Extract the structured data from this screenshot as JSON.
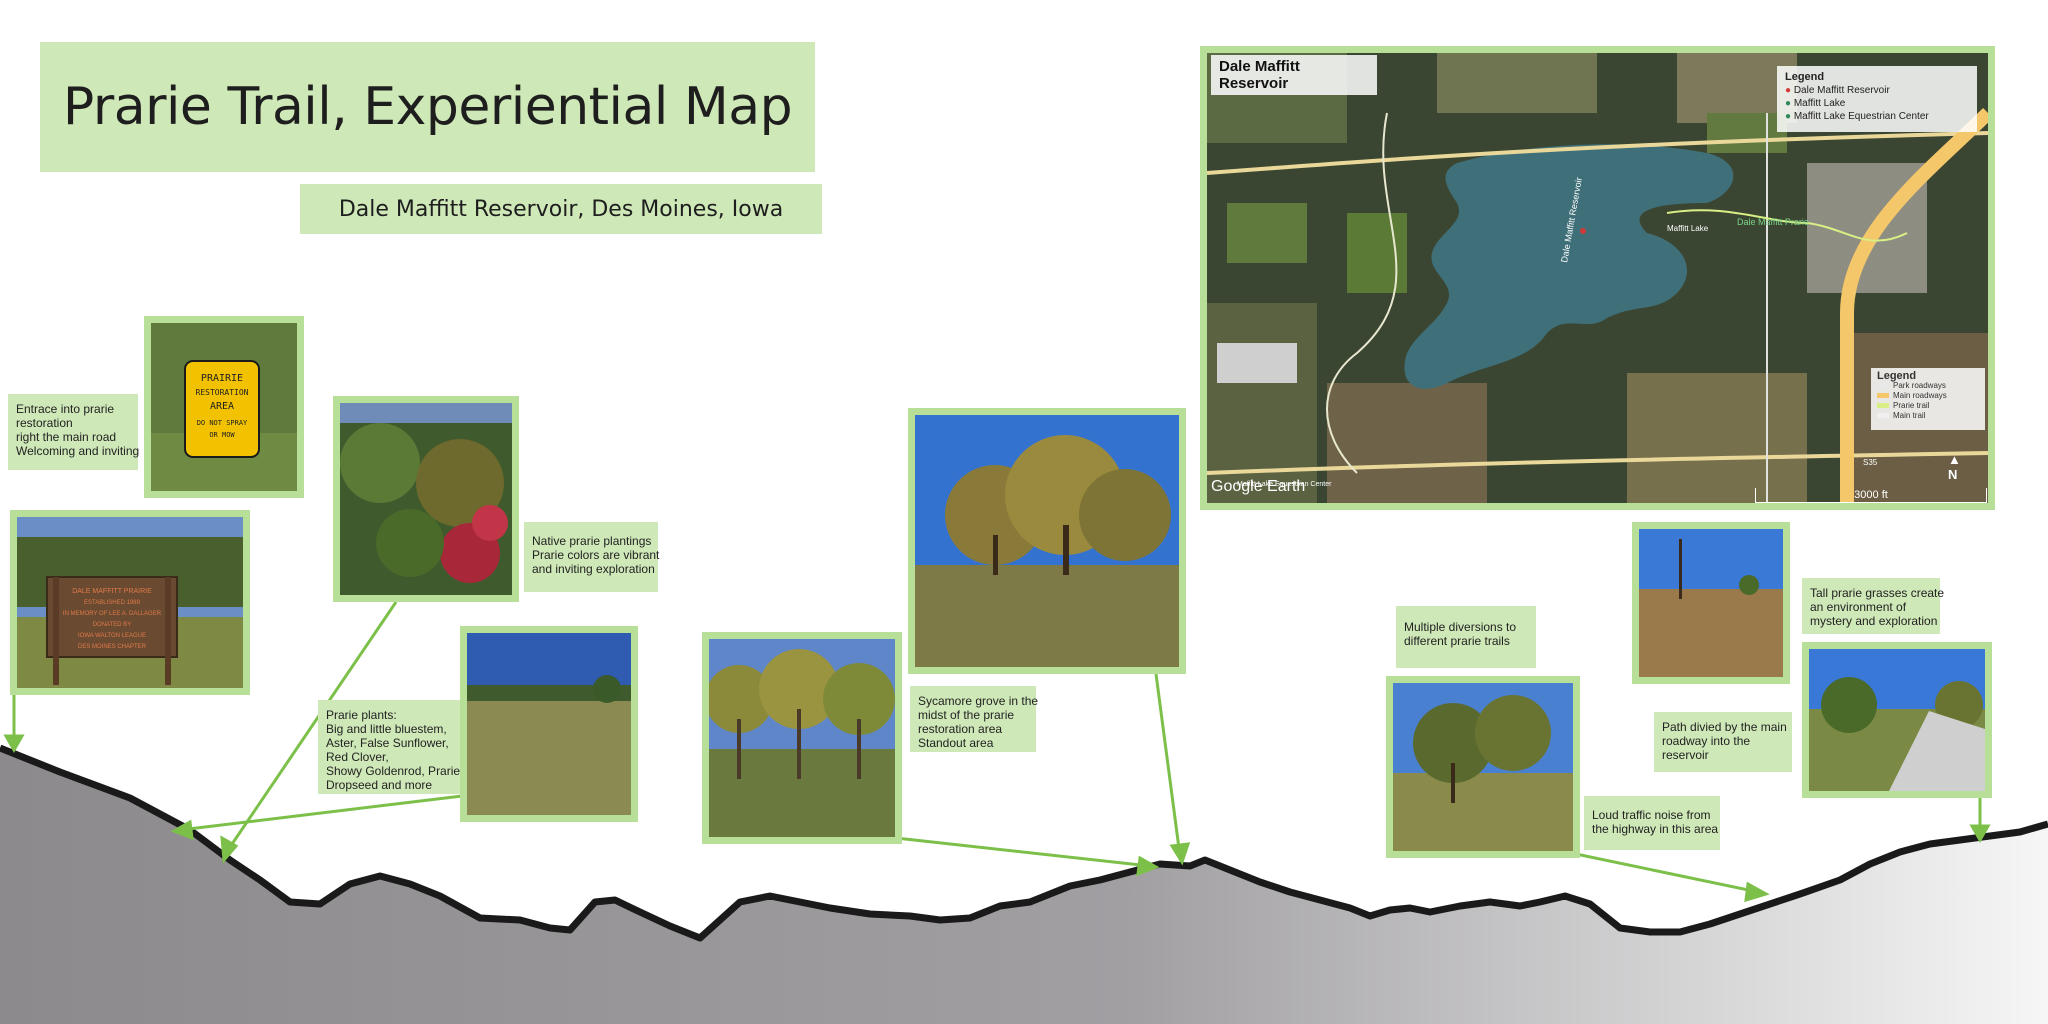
{
  "title": "Prarie Trail, Experiential  Map",
  "subtitle": "Dale Maffitt Reservoir, Des Moines, Iowa",
  "map": {
    "title_line1": "Dale Maffitt",
    "title_line2": "Reservoir",
    "legend_title": "Legend",
    "legend_items": [
      "Dale Maffitt Reservoir",
      "Maffitt Lake",
      "Maffitt Lake Equestrian Center"
    ],
    "legend2_title": "Legend",
    "legend2_items": [
      "Park roadways",
      "Main roadways",
      "Prarie trail",
      "Main trail"
    ],
    "legend2_colors": [
      "#e8e8e8",
      "#f4c86a",
      "#d8ef86",
      "#f0f0f0"
    ],
    "watermark": "Google Earth",
    "scale": "3000 ft",
    "north": "N",
    "label_reservoir": "Dale Maffitt Reservoir",
    "label_lake": "Maffitt Lake",
    "label_trail": "Dale Maffitt Prarie",
    "label_equestrian": "Maffitt Lake Equestrian Center",
    "route_number": "S35",
    "colors": {
      "water": "#3f6f78",
      "forest": "#2f3a27",
      "field": "#6f7a4e",
      "road": "#e9d89a",
      "highway": "#f4c86a"
    }
  },
  "notes": {
    "entrance": [
      "Entrace into prarie",
      "restoration",
      "right the main road",
      "Welcoming and inviting"
    ],
    "native": [
      "Native prarie plantings",
      "Prarie colors are vibrant",
      "and inviting exploration"
    ],
    "plants": [
      "Prarie plants:",
      "Big and little bluestem,",
      "Aster, False Sunflower,",
      "Red Clover,",
      "Showy Goldenrod, Prarie",
      "Dropseed and more"
    ],
    "sycamore": [
      "Sycamore grove in the",
      "midst of the prarie",
      "restoration area",
      "Standout area"
    ],
    "diversions": [
      "Multiple diversions to",
      "different prarie trails"
    ],
    "traffic": [
      "Loud traffic noise from",
      "the highway in this area"
    ],
    "path": [
      "Path divied by the main",
      "roadway into the",
      "reservoir"
    ],
    "tall": [
      "Tall prarie grasses create",
      "an environment of",
      "mystery and exploration"
    ]
  },
  "signs": {
    "prairie_sign": [
      "PRAIRIE",
      "RESTORATION",
      "AREA",
      "DO NOT SPRAY",
      "OR MOW"
    ],
    "memorial_sign": [
      "DALE MAFFITT PRAIRIE",
      "ESTABLISHED 1989",
      "IN MEMORY OF LEE A. DALLAGER",
      "DONATED BY",
      "IOWA WALTON LEAGUE",
      "DES MOINES CHAPTER"
    ]
  },
  "colors": {
    "accent": "#7cc04a",
    "panel": "#cfe8b8",
    "frame": "#b8df98",
    "terrain_line": "#1a1a1a"
  }
}
